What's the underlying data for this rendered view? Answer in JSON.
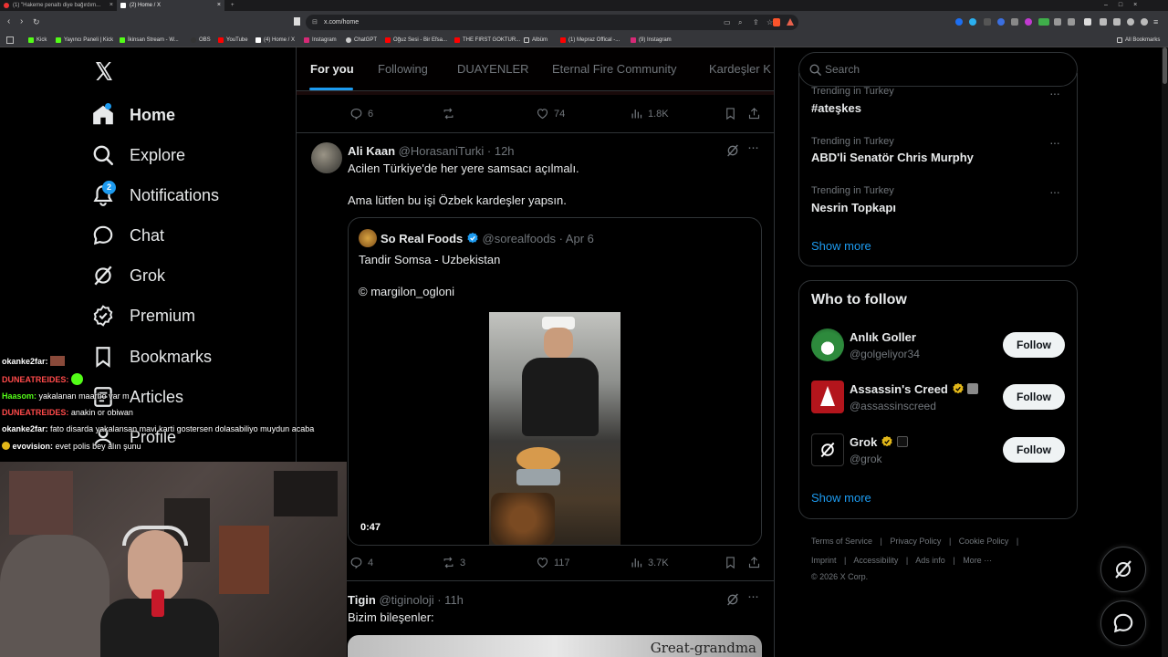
{
  "browser": {
    "tabs": [
      {
        "title": "(1) \"Hakeme penaltı diye bağırdım..."
      },
      {
        "title": "(2) Home / X"
      }
    ],
    "url": "x.com/home",
    "bookmarks": [
      "Kick",
      "Yayıncı Paneli | Kick",
      "İkinsan Stream - W...",
      "OBS",
      "YouTube",
      "(4) Home / X",
      "Instagram",
      "ChatGPT",
      "Oğuz Sesi - Bir Efsa...",
      "THE FIRST GOKTUR...",
      "Albüm",
      "(1) Mepraz Offical -...",
      "(9) Instagram"
    ],
    "all_bookmarks": "All Bookmarks"
  },
  "sidebar": {
    "notification_count": "2",
    "items": [
      {
        "label": "Home",
        "icon": "home-icon"
      },
      {
        "label": "Explore",
        "icon": "search-icon"
      },
      {
        "label": "Notifications",
        "icon": "bell-icon"
      },
      {
        "label": "Chat",
        "icon": "chat-icon"
      },
      {
        "label": "Grok",
        "icon": "grok-icon"
      },
      {
        "label": "Premium",
        "icon": "verified-icon"
      },
      {
        "label": "Bookmarks",
        "icon": "bookmark-icon"
      },
      {
        "label": "Articles",
        "icon": "article-icon"
      },
      {
        "label": "Profile",
        "icon": "profile-icon"
      }
    ]
  },
  "feed": {
    "tabs": [
      "For you",
      "Following",
      "DUAYENLER",
      "Eternal Fire Community",
      "Kardeşler K"
    ],
    "prev_post_actions": {
      "replies": "6",
      "likes": "74",
      "views": "1.8K"
    },
    "post1": {
      "name": "Ali Kaan",
      "handle": "@HorasaniTurki",
      "time": "· 12h",
      "line1": "Acilen Türkiye'de her yere samsacı açılmalı.",
      "line2": "Ama lütfen bu işi Özbek kardeşler yapsın.",
      "quote": {
        "name": "So Real Foods",
        "handle": "@sorealfoods",
        "time": "· Apr 6",
        "line1": "Tandir Somsa - Uzbekistan",
        "line2": "© margilon_ogloni",
        "video_duration": "0:47"
      },
      "actions": {
        "replies": "4",
        "reposts": "3",
        "likes": "117",
        "views": "3.7K"
      }
    },
    "post2": {
      "name": "Tigin",
      "handle": "@tiginoloji",
      "time": "· 11h",
      "text": "Bizim bileşenler:",
      "image_caption": "Great-grandma"
    }
  },
  "right": {
    "search_placeholder": "Search",
    "trends": [
      {
        "sub": "Trending in Turkey",
        "main": "#ateşkes"
      },
      {
        "sub": "Trending in Turkey",
        "main": "ABD'li Senatör Chris Murphy"
      },
      {
        "sub": "Trending in Turkey",
        "main": "Nesrin Topkapı"
      }
    ],
    "show_more": "Show more",
    "who_to_follow": "Who to follow",
    "follow_label": "Follow",
    "suggestions": [
      {
        "name": "Anlık Goller",
        "handle": "@golgeliyor34"
      },
      {
        "name": "Assassin's Creed",
        "handle": "@assassinscreed"
      },
      {
        "name": "Grok",
        "handle": "@grok"
      }
    ],
    "footer": {
      "row1": [
        "Terms of Service",
        "|",
        "Privacy Policy",
        "|",
        "Cookie Policy",
        "|"
      ],
      "row2": [
        "Imprint",
        "|",
        "Accessibility",
        "|",
        "Ads info",
        "|",
        "More ···"
      ],
      "copyright": "© 2026 X Corp."
    }
  },
  "stream_chat": [
    {
      "user": "okanke2far:",
      "text": "",
      "color": "#ffffff"
    },
    {
      "user": "DUNEATREIDES:",
      "text": "",
      "color": "#ff4a4a"
    },
    {
      "user": "Haasom:",
      "text": "yakalanan maarbo var m",
      "color": "#53fc18"
    },
    {
      "user": "DUNEATREIDES:",
      "text": "anakin or obiwan",
      "color": "#ff4a4a"
    },
    {
      "user": "okanke2far:",
      "text": "fato disarda yakalansan mavi karti gostersen dolasabiliyo muydun acaba",
      "color": "#ffffff"
    },
    {
      "user": "evovision:",
      "text": "evet polis bey alın şunu",
      "color": "#ffffff"
    }
  ],
  "colors": {
    "accent": "#1d9bf0",
    "background": "#000000",
    "border": "#2f3336",
    "muted": "#71767b",
    "verified_gold": "#e2b719"
  }
}
